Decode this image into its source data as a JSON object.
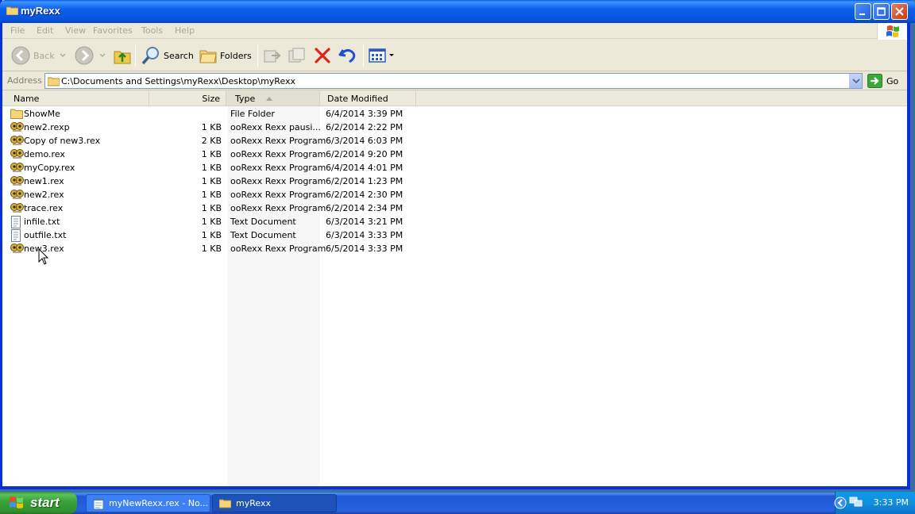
{
  "window": {
    "title": "myRexx"
  },
  "menu": [
    "File",
    "Edit",
    "View",
    "Favorites",
    "Tools",
    "Help"
  ],
  "toolbar": {
    "back_label": "Back",
    "search_label": "Search",
    "folders_label": "Folders"
  },
  "address": {
    "label": "Address",
    "path": "C:\\Documents and Settings\\myRexx\\Desktop\\myRexx",
    "go_label": "Go"
  },
  "columns": {
    "name": "Name",
    "size": "Size",
    "type": "Type",
    "date": "Date Modified"
  },
  "files": [
    {
      "name": "ShowMe",
      "size": "",
      "type": "File Folder",
      "date": "6/4/2014 3:39 PM",
      "icon": "folder-icon"
    },
    {
      "name": "new2.rexp",
      "size": "1 KB",
      "type": "ooRexx Rexx pausi...",
      "date": "6/2/2014 2:22 PM",
      "icon": "rexx-file-icon"
    },
    {
      "name": "Copy of new3.rex",
      "size": "2 KB",
      "type": "ooRexx Rexx Program",
      "date": "6/3/2014 6:03 PM",
      "icon": "rexx-file-icon"
    },
    {
      "name": "demo.rex",
      "size": "1 KB",
      "type": "ooRexx Rexx Program",
      "date": "6/2/2014 9:20 PM",
      "icon": "rexx-file-icon"
    },
    {
      "name": "myCopy.rex",
      "size": "1 KB",
      "type": "ooRexx Rexx Program",
      "date": "6/4/2014 4:01 PM",
      "icon": "rexx-file-icon"
    },
    {
      "name": "new1.rex",
      "size": "1 KB",
      "type": "ooRexx Rexx Program",
      "date": "6/2/2014 1:23 PM",
      "icon": "rexx-file-icon"
    },
    {
      "name": "new2.rex",
      "size": "1 KB",
      "type": "ooRexx Rexx Program",
      "date": "6/2/2014 2:30 PM",
      "icon": "rexx-file-icon"
    },
    {
      "name": "trace.rex",
      "size": "1 KB",
      "type": "ooRexx Rexx Program",
      "date": "6/2/2014 2:34 PM",
      "icon": "rexx-file-icon"
    },
    {
      "name": "infile.txt",
      "size": "1 KB",
      "type": "Text Document",
      "date": "6/3/2014 3:21 PM",
      "icon": "text-file-icon"
    },
    {
      "name": "outfile.txt",
      "size": "1 KB",
      "type": "Text Document",
      "date": "6/3/2014 3:33 PM",
      "icon": "text-file-icon"
    },
    {
      "name": "new3.rex",
      "size": "1 KB",
      "type": "ooRexx Rexx Program",
      "date": "6/5/2014 3:33 PM",
      "icon": "rexx-file-icon"
    }
  ],
  "taskbar": {
    "start_label": "start",
    "tasks": [
      {
        "label": "myNewRexx.rex - No...",
        "icon": "notepad-icon"
      },
      {
        "label": "myRexx",
        "icon": "folder-icon"
      }
    ],
    "clock": "3:33 PM"
  }
}
